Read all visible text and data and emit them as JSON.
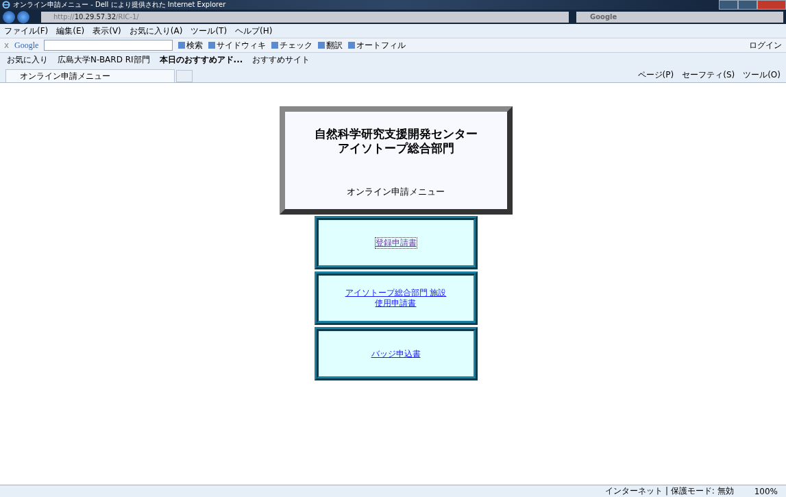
{
  "window": {
    "title": "オンライン申請メニュー - Dell により提供された Internet Explorer"
  },
  "address_bar": {
    "url_prefix": "http://",
    "url_host": "10.29.57.32",
    "url_path": "/RIC-1/",
    "search_placeholder": "Google"
  },
  "menu_bar": [
    "ファイル(F)",
    "編集(E)",
    "表示(V)",
    "お気に入り(A)",
    "ツール(T)",
    "ヘルプ(H)"
  ],
  "google_toolbar": {
    "close": "x",
    "brand": "Google",
    "buttons": [
      {
        "kind": "icon-label",
        "label": "検索"
      },
      {
        "kind": "icon-label",
        "label": "サイドウィキ"
      },
      {
        "kind": "icon-label",
        "label": "チェック"
      },
      {
        "kind": "icon-label",
        "label": "翻訳"
      },
      {
        "kind": "icon-label",
        "label": "オートフィル"
      }
    ],
    "login": "ログイン"
  },
  "favorites_bar": {
    "label": "お気に入り",
    "items": [
      "広島大学N-BARD RI部門",
      "本日のおすすめアド...",
      "おすすめサイト"
    ]
  },
  "tabs": [
    {
      "label": "オンライン申請メニュー",
      "selected": true
    }
  ],
  "command_bar": [
    "ページ(P)",
    "セーフティ(S)",
    "ツール(O)"
  ],
  "page": {
    "heading": [
      "自然科学研究支援開発センター",
      "アイソトープ総合部門"
    ],
    "subtitle": "オンライン申請メニュー",
    "links": [
      {
        "lines": [
          "登録申請書"
        ],
        "visited": true
      },
      {
        "lines": [
          "アイソトープ総合部門 施設",
          "使用申請書"
        ],
        "visited": false
      },
      {
        "lines": [
          "バッジ申込書"
        ],
        "visited": false
      }
    ]
  },
  "status_bar": {
    "zone": "インターネット | 保護モード: 無効",
    "zoom": "100%"
  }
}
